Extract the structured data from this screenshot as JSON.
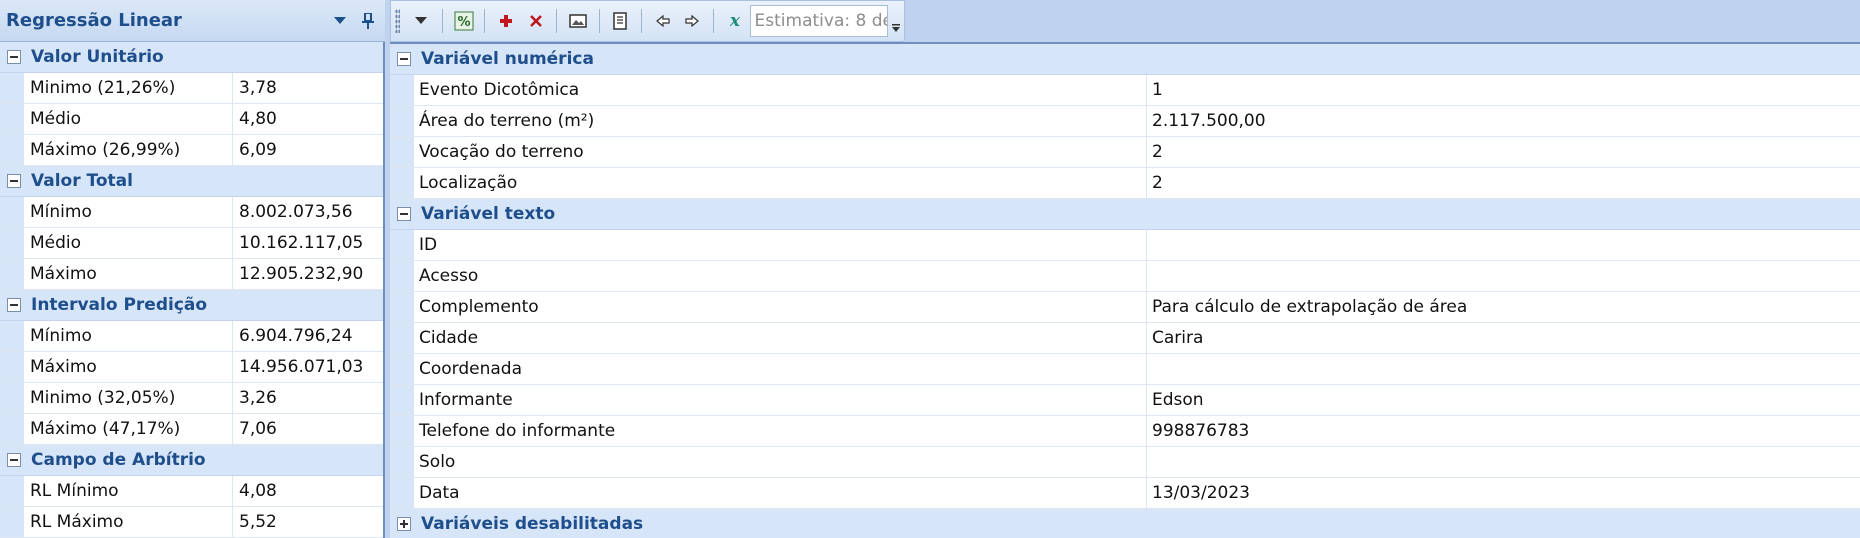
{
  "left_panel": {
    "title": "Regressão Linear",
    "groups": [
      {
        "label": "Valor Unitário",
        "rows": [
          {
            "name": "Minimo (21,26%)",
            "value": "3,78"
          },
          {
            "name": "Médio",
            "value": "4,80"
          },
          {
            "name": "Máximo (26,99%)",
            "value": "6,09"
          }
        ]
      },
      {
        "label": "Valor Total",
        "rows": [
          {
            "name": "Mínimo",
            "value": "8.002.073,56"
          },
          {
            "name": "Médio",
            "value": "10.162.117,05"
          },
          {
            "name": "Máximo",
            "value": "12.905.232,90"
          }
        ]
      },
      {
        "label": "Intervalo Predição",
        "rows": [
          {
            "name": "Mínimo",
            "value": "6.904.796,24"
          },
          {
            "name": "Máximo",
            "value": "14.956.071,03"
          },
          {
            "name": "Minimo (32,05%)",
            "value": "3,26"
          },
          {
            "name": "Máximo (47,17%)",
            "value": "7,06"
          }
        ]
      },
      {
        "label": "Campo de Arbítrio",
        "rows": [
          {
            "name": "RL Mínimo",
            "value": "4,08"
          },
          {
            "name": "RL Máximo",
            "value": "5,52"
          }
        ]
      }
    ]
  },
  "toolbar": {
    "estimate_value": "Estimativa: 8 de",
    "icons": [
      "dropdown-arrow-icon",
      "percent-icon",
      "add-icon",
      "delete-icon",
      "image-icon",
      "document-icon",
      "previous-icon",
      "next-icon",
      "formula-x-icon"
    ]
  },
  "main_grid": {
    "groups": [
      {
        "label": "Variável numérica",
        "expanded": true,
        "rows": [
          {
            "name": "Evento Dicotômica",
            "value": "1"
          },
          {
            "name": "Área do terreno (m²)",
            "value": "2.117.500,00"
          },
          {
            "name": "Vocação do terreno",
            "value": "2"
          },
          {
            "name": "Localização",
            "value": "2"
          }
        ]
      },
      {
        "label": "Variável texto",
        "expanded": true,
        "rows": [
          {
            "name": "ID",
            "value": ""
          },
          {
            "name": "Acesso",
            "value": ""
          },
          {
            "name": "Complemento",
            "value": "Para cálculo de extrapolação de área"
          },
          {
            "name": "Cidade",
            "value": "Carira"
          },
          {
            "name": "Coordenada",
            "value": ""
          },
          {
            "name": "Informante",
            "value": "Edson"
          },
          {
            "name": "Telefone do informante",
            "value": "998876783"
          },
          {
            "name": "Solo",
            "value": ""
          },
          {
            "name": "Data",
            "value": "13/03/2023"
          }
        ]
      },
      {
        "label": "Variáveis desabilitadas",
        "expanded": false,
        "rows": []
      }
    ]
  },
  "colors": {
    "category_text": "#1e4e8c",
    "category_bg": "#d6e5f7",
    "add_icon": "#c0161c",
    "delete_icon": "#c0161c",
    "formula_icon": "#1d8a7a"
  }
}
